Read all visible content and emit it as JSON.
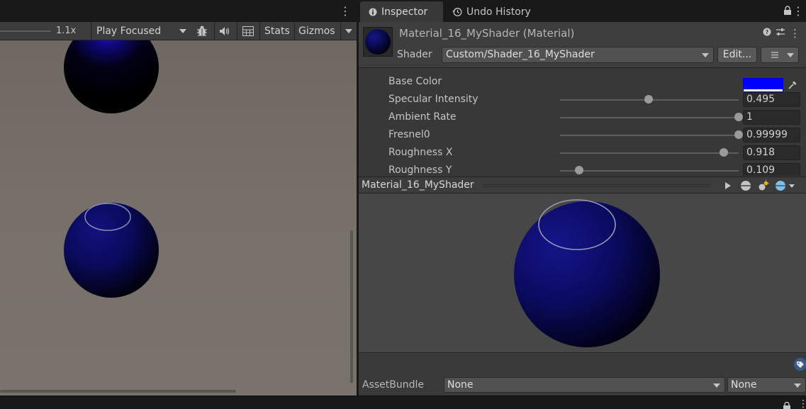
{
  "game_view": {
    "toolbar": {
      "scale_label": "1.1x",
      "play_mode": "Play Focused",
      "stats_label": "Stats",
      "gizmos_label": "Gizmos"
    },
    "menu_icon": "kebab-menu-icon"
  },
  "inspector": {
    "tabs": [
      {
        "label": "Inspector",
        "icon": "info-icon",
        "active": true
      },
      {
        "label": "Undo History",
        "icon": "history-icon",
        "active": false
      }
    ],
    "material": {
      "title": "Material_16_MyShader (Material)",
      "shader_label": "Shader",
      "shader_value": "Custom/Shader_16_MyShader",
      "edit_label": "Edit..."
    },
    "properties": [
      {
        "label": "Base Color",
        "type": "color",
        "color": "#0000ff"
      },
      {
        "label": "Specular Intensity",
        "type": "slider",
        "value": "0.495",
        "fraction": 0.495
      },
      {
        "label": "Ambient Rate",
        "type": "slider",
        "value": "1",
        "fraction": 1.0
      },
      {
        "label": "Fresnel0",
        "type": "slider",
        "value": "0.99999",
        "fraction": 0.99999
      },
      {
        "label": "Roughness X",
        "type": "slider",
        "value": "0.918",
        "fraction": 0.918
      },
      {
        "label": "Roughness Y",
        "type": "slider",
        "value": "0.109",
        "fraction": 0.109
      }
    ],
    "preview": {
      "title": "Material_16_MyShader"
    },
    "asset_bundle": {
      "label": "AssetBundle",
      "name_value": "None",
      "variant_value": "None"
    }
  },
  "colors": {
    "panel_bg": "#383838",
    "scene_bg": "#77706a",
    "base_color": "#0000ff",
    "sphere_blue": "#0a0a78"
  }
}
